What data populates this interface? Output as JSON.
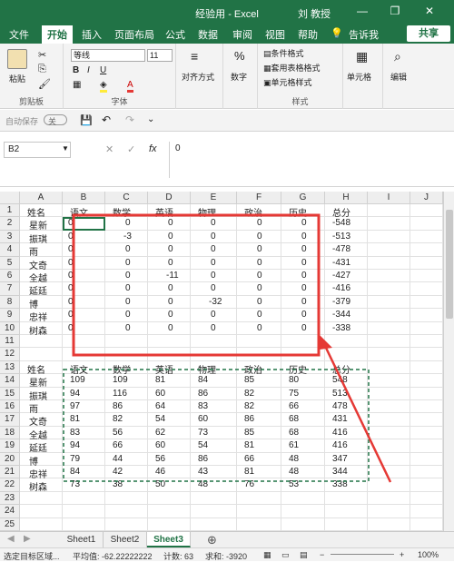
{
  "window": {
    "title": "经验用  -  Excel",
    "user": "刘 教授",
    "minimize": "—",
    "restore": "❐",
    "close": "✕"
  },
  "tabs": [
    "文件",
    "开始",
    "插入",
    "页面布局",
    "公式",
    "数据",
    "审阅",
    "视图",
    "帮助"
  ],
  "tell_me": "告诉我",
  "share": "共享",
  "ribbon": {
    "paste": "粘贴",
    "clipboard": "剪贴板",
    "font_name": "等线",
    "font_size": "11",
    "font_group": "字体",
    "align_label": "对齐方式",
    "number_label": "数字",
    "cond_format": "条件格式",
    "table_format": "套用表格格式",
    "cell_style": "单元格样式",
    "style_group": "样式",
    "cells_label": "单元格",
    "edit_label": "编辑"
  },
  "qat": {
    "autosave": "自动保存",
    "autosave_state": "关"
  },
  "formula": {
    "name_box": "B2",
    "value": "0",
    "fx": "fx"
  },
  "columns": [
    "A",
    "B",
    "C",
    "D",
    "E",
    "F",
    "G",
    "H",
    "I",
    "J"
  ],
  "rows": [
    "1",
    "2",
    "3",
    "4",
    "5",
    "6",
    "7",
    "8",
    "9",
    "10",
    "11",
    "12",
    "13",
    "14",
    "15",
    "16",
    "17",
    "18",
    "19",
    "20",
    "21",
    "22",
    "23",
    "24",
    "25"
  ],
  "headers": [
    "姓名",
    "语文",
    "数学",
    "英语",
    "物理",
    "政治",
    "历史",
    "总分"
  ],
  "table1": [
    [
      "星新",
      "0",
      "0",
      "0",
      "0",
      "0",
      "0",
      "-548"
    ],
    [
      "振琪",
      "0",
      "-3",
      "0",
      "0",
      "0",
      "0",
      "-513"
    ],
    [
      "雨",
      "0",
      "0",
      "0",
      "0",
      "0",
      "0",
      "-478"
    ],
    [
      "文奇",
      "0",
      "0",
      "0",
      "0",
      "0",
      "0",
      "-431"
    ],
    [
      "全越",
      "0",
      "0",
      "-11",
      "0",
      "0",
      "0",
      "-427"
    ],
    [
      "延廷",
      "0",
      "0",
      "0",
      "0",
      "0",
      "0",
      "-416"
    ],
    [
      "博",
      "0",
      "0",
      "0",
      "-32",
      "0",
      "0",
      "-379"
    ],
    [
      "忠祥",
      "0",
      "0",
      "0",
      "0",
      "0",
      "0",
      "-344"
    ],
    [
      "树森",
      "0",
      "0",
      "0",
      "0",
      "0",
      "0",
      "-338"
    ]
  ],
  "table2": [
    [
      "星新",
      "109",
      "109",
      "81",
      "84",
      "85",
      "80",
      "548"
    ],
    [
      "振琪",
      "94",
      "116",
      "60",
      "86",
      "82",
      "75",
      "513"
    ],
    [
      "雨",
      "97",
      "86",
      "64",
      "83",
      "82",
      "66",
      "478"
    ],
    [
      "文奇",
      "81",
      "82",
      "54",
      "60",
      "86",
      "68",
      "431"
    ],
    [
      "全越",
      "83",
      "56",
      "62",
      "73",
      "85",
      "68",
      "416"
    ],
    [
      "延廷",
      "94",
      "66",
      "60",
      "54",
      "81",
      "61",
      "416"
    ],
    [
      "博",
      "79",
      "44",
      "56",
      "86",
      "66",
      "48",
      "347"
    ],
    [
      "忠祥",
      "84",
      "42",
      "46",
      "43",
      "81",
      "48",
      "344"
    ],
    [
      "树森",
      "73",
      "38",
      "50",
      "48",
      "76",
      "53",
      "338"
    ]
  ],
  "sheets": [
    "Sheet1",
    "Sheet2",
    "Sheet3"
  ],
  "status": {
    "mode": "选定目标区域...",
    "average": "平均值: -62.22222222",
    "count": "计数: 63",
    "sum": "求和: -3920",
    "zoom": "100%"
  },
  "colors": {
    "excel_green": "#217346",
    "highlight_red": "#e53935",
    "marquee_green": "#217346"
  }
}
